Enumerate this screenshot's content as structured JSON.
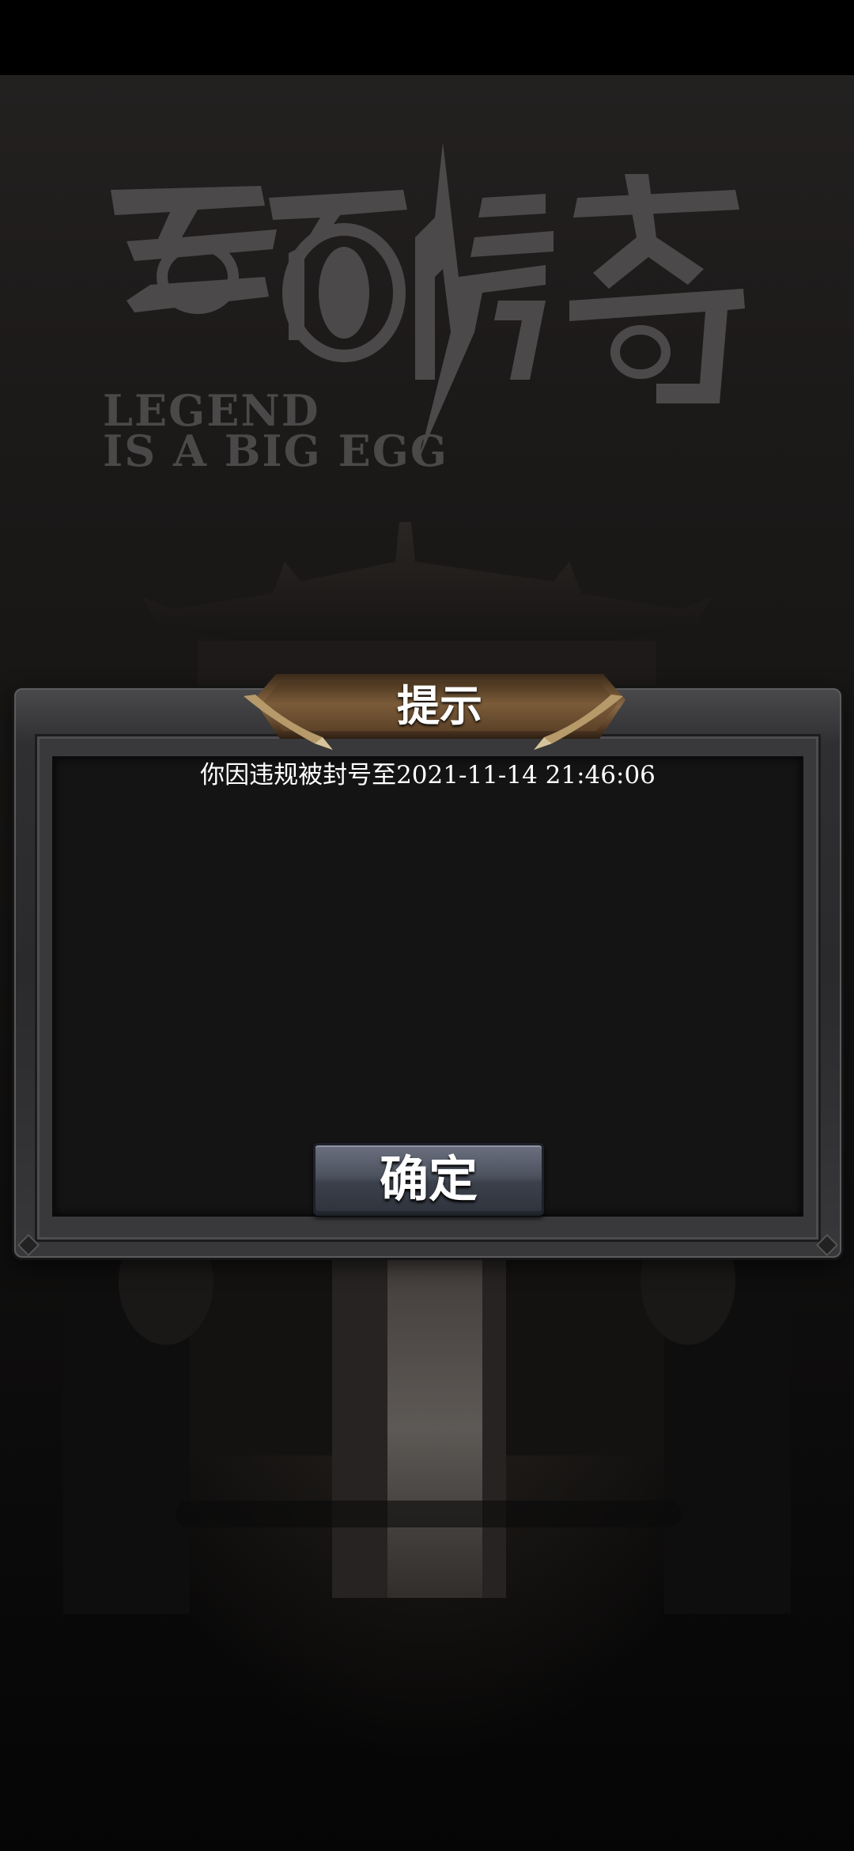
{
  "logo": {
    "title_text": "蛋蛋传奇",
    "subtitle_line1": "LEGEND",
    "subtitle_line2": "IS A BIG EGG"
  },
  "dialog": {
    "title": "提示",
    "message": "你因违规被封号至2021-11-14 21:46:06",
    "confirm_label": "确定"
  },
  "colors": {
    "background": "#151413",
    "panel": "#141414",
    "frame": "#2f2f31",
    "title_plate": "#7a5b39",
    "button": "#4c525e",
    "logo": "#4a4848"
  }
}
